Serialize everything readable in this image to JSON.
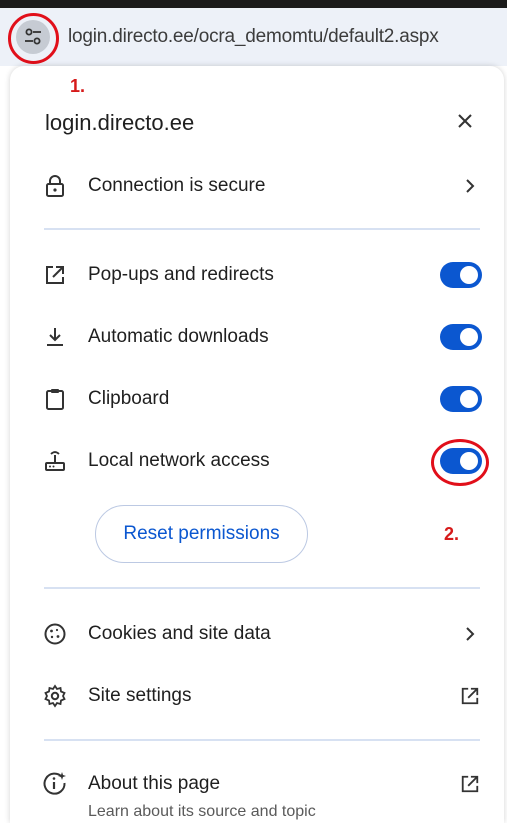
{
  "addressbar": {
    "url": "login.directo.ee/ocra_demomtu/default2.aspx"
  },
  "annotations": {
    "marker_1": "1.",
    "marker_2": "2.",
    "color": "#e10f1a"
  },
  "popup": {
    "title": "login.directo.ee",
    "connection": {
      "label": "Connection is secure",
      "icon": "lock-icon"
    },
    "permissions": [
      {
        "label": "Pop-ups and redirects",
        "icon": "open-in-new-icon",
        "enabled": true
      },
      {
        "label": "Automatic downloads",
        "icon": "download-icon",
        "enabled": true
      },
      {
        "label": "Clipboard",
        "icon": "clipboard-icon",
        "enabled": true
      },
      {
        "label": "Local network access",
        "icon": "router-icon",
        "enabled": true
      }
    ],
    "reset_label": "Reset permissions",
    "cookies_label": "Cookies and site data",
    "site_settings_label": "Site settings",
    "about": {
      "label": "About this page",
      "sublabel": "Learn about its source and topic"
    }
  },
  "colors": {
    "accent": "#0b57d0",
    "divider": "#d7e1f2",
    "address_bg": "#edf1f8"
  }
}
